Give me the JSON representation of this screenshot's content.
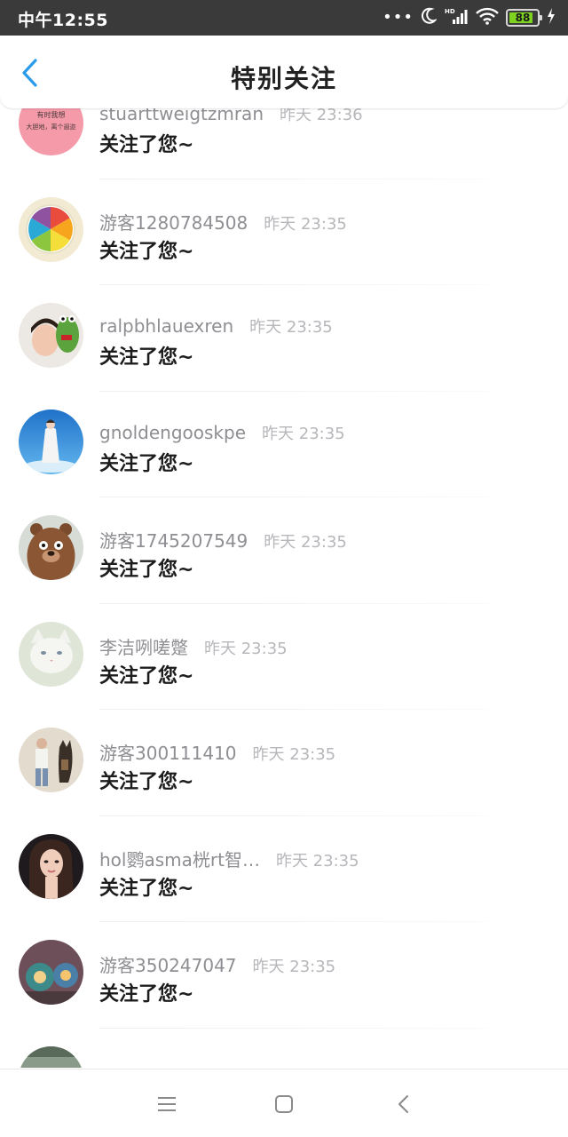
{
  "status_bar": {
    "time": "中午12:55",
    "dots": "•••",
    "battery_level": "88",
    "battery_fraction": 0.88,
    "icons": [
      "moon-icon",
      "hd-signal-icon",
      "wifi-icon",
      "battery-icon",
      "charging-icon"
    ]
  },
  "header": {
    "title": "特别关注",
    "back_icon": "chevron-left-icon",
    "accent": "#2a9bea"
  },
  "colors": {
    "username": "#8e8e93",
    "timestamp": "#b7b7bb",
    "message": "#1c1c1c"
  },
  "followers": [
    {
      "username": "stuarttweigtzmran",
      "time": "昨天 23:36",
      "message": "关注了您~",
      "avatar": "pink-text-avatar",
      "avatar_text_1": "有时我想",
      "avatar_text_2": "大胆地，离个遐迩"
    },
    {
      "username": "游客1280784508",
      "time": "昨天 23:35",
      "message": "关注了您~",
      "avatar": "citrus-slice-avatar"
    },
    {
      "username": "ralpbhlauexren",
      "time": "昨天 23:35",
      "message": "关注了您~",
      "avatar": "girl-with-frog-avatar"
    },
    {
      "username": "gnoldengooskpe",
      "time": "昨天 23:35",
      "message": "关注了您~",
      "avatar": "woman-blue-sky-avatar"
    },
    {
      "username": "游客1745207549",
      "time": "昨天 23:35",
      "message": "关注了您~",
      "avatar": "brown-bear-avatar"
    },
    {
      "username": "李洁咧嗟蹩",
      "time": "昨天 23:35",
      "message": "关注了您~",
      "avatar": "white-cat-avatar"
    },
    {
      "username": "游客300111410",
      "time": "昨天 23:35",
      "message": "关注了您~",
      "avatar": "man-with-dog-avatar"
    },
    {
      "username": "hol鹦asma桄rt智…",
      "time": "昨天 23:35",
      "message": "关注了您~",
      "avatar": "woman-portrait-avatar"
    },
    {
      "username": "游客350247047",
      "time": "昨天 23:35",
      "message": "关注了您~",
      "avatar": "candle-jars-avatar"
    },
    {
      "username": "",
      "time": "",
      "message": "",
      "avatar": "partial-avatar"
    }
  ],
  "nav_bar": {
    "buttons": [
      "menu-icon",
      "home-square-icon",
      "back-triangle-icon"
    ]
  }
}
